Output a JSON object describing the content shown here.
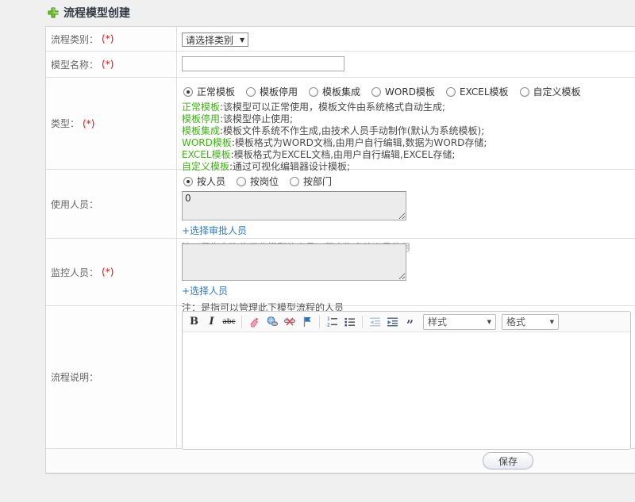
{
  "colors": {
    "accent_green": "#3eb213",
    "link_blue": "#2e7bbf",
    "required_red": "#ff0000",
    "title_color": "#333a45"
  },
  "header": {
    "title": "流程模型创建",
    "icon": "plus-icon"
  },
  "form": {
    "category": {
      "label": "流程类别：",
      "required": "(*)",
      "select_value": "请选择类别",
      "caret": "▼"
    },
    "model_name": {
      "label": "模型名称：",
      "required": "(*)",
      "input_value": ""
    },
    "type": {
      "label": "类型：",
      "required": "(*)",
      "options": [
        {
          "label": "正常模板",
          "selected": true
        },
        {
          "label": "模板停用",
          "selected": false
        },
        {
          "label": "模板集成",
          "selected": false
        },
        {
          "label": "WORD模板",
          "selected": false
        },
        {
          "label": "EXCEL模板",
          "selected": false
        },
        {
          "label": "自定义模板",
          "selected": false
        }
      ],
      "descriptions": [
        {
          "term": "正常模板",
          "text": ":该模型可以正常使用，模板文件由系统格式自动生成;"
        },
        {
          "term": "模板停用",
          "text": ":该模型停止使用;"
        },
        {
          "term": "模板集成",
          "text": ":模板文件系统不作生成,由技术人员手动制作(默认为系统模板);"
        },
        {
          "term": "WORD模板",
          "text": ":模板格式为WORD文档,由用户自行编辑,数据为WORD存储;"
        },
        {
          "term": "EXCEL模板",
          "text": ":模板格式为EXCEL文档,由用户自行编辑,EXCEL存储;"
        },
        {
          "term": "自定义模板",
          "text": ":通过可视化编辑器设计模板;"
        }
      ]
    },
    "users": {
      "label": "使用人员：",
      "mode_options": [
        {
          "label": "按人员",
          "selected": true
        },
        {
          "label": "按岗位",
          "selected": false
        },
        {
          "label": "按部门",
          "selected": false
        }
      ],
      "textarea_value": "0",
      "link": "+选择审批人员",
      "note": "注：是指允许使用此模型的人员，留空为全体人员使用"
    },
    "monitors": {
      "label": "监控人员：",
      "required": "(*)",
      "textarea_value": "",
      "link": "+选择人员",
      "note": "注：是指可以管理此下模型流程的人员"
    },
    "description": {
      "label": "流程说明：",
      "editor": {
        "icons": [
          "bold",
          "italic",
          "strikethrough",
          "remove-format",
          "link",
          "unlink",
          "flag",
          "numbered-list",
          "bulleted-list",
          "outdent",
          "indent",
          "blockquote"
        ],
        "glyphs": {
          "bold": "B",
          "italic": "I",
          "strike": "abc",
          "quote": "”"
        },
        "style_dropdown": "样式",
        "format_dropdown": "格式",
        "dd_caret": "▼",
        "body_text": ""
      }
    }
  },
  "footer": {
    "save_label": "保存"
  }
}
